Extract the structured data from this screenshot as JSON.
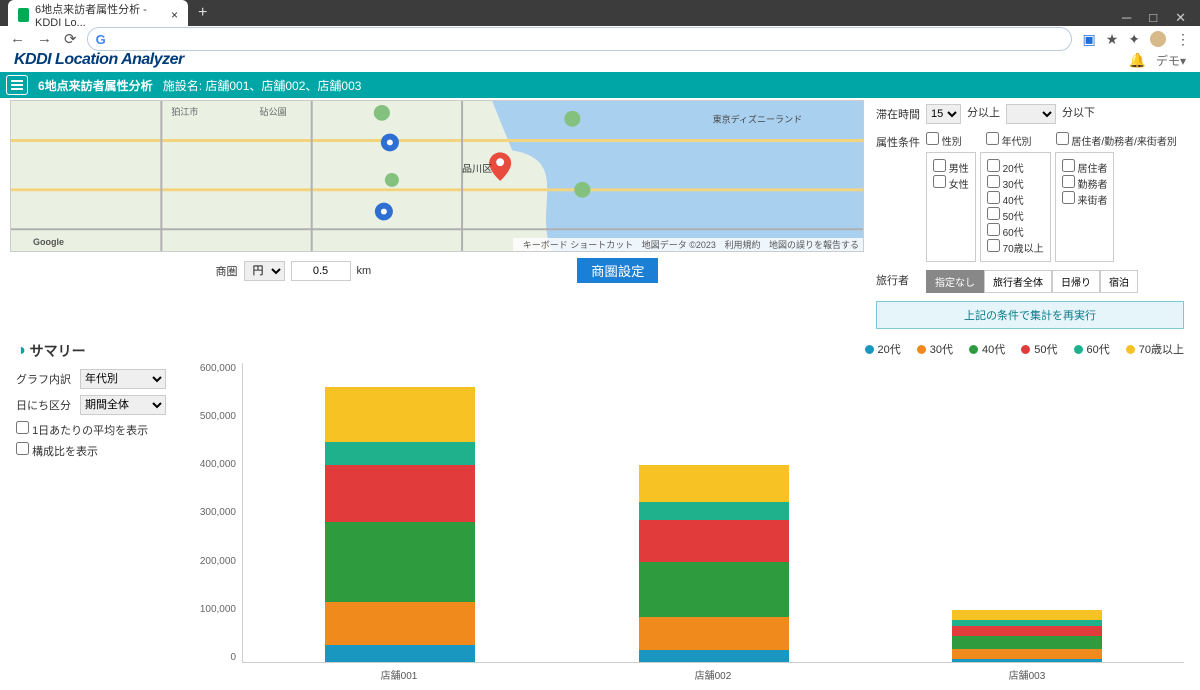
{
  "browser": {
    "tab_title": "6地点来訪者属性分析 - KDDI Lo...",
    "url": ""
  },
  "app": {
    "logo": "KDDI Location Analyzer",
    "user": "デモ▾"
  },
  "tealbar": {
    "title": "6地点来訪者属性分析",
    "subtitle": "施設名: 店舗001、店舗002、店舗003"
  },
  "map": {
    "credits": [
      "キーボード ショートカット",
      "地図データ ©2023",
      "利用規約",
      "地図の誤りを報告する"
    ]
  },
  "area_control": {
    "label": "商圏",
    "shape": "円",
    "radius": "0.5",
    "unit": "km",
    "button": "商圏設定"
  },
  "filters": {
    "stay": {
      "label": "滞在時間",
      "min_value": "15",
      "min_suffix": "分以上",
      "max_value": "",
      "max_suffix": "分以下"
    },
    "attr": {
      "label": "属性条件",
      "headers": [
        "性別",
        "年代別",
        "居住者/勤務者/来街者別"
      ],
      "gender": [
        "男性",
        "女性"
      ],
      "age": [
        "20代",
        "30代",
        "40代",
        "50代",
        "60代",
        "70歳以上"
      ],
      "type": [
        "居住者",
        "勤務者",
        "来街者"
      ]
    },
    "traveler": {
      "label": "旅行者",
      "options": [
        "指定なし",
        "旅行者全体",
        "日帰り",
        "宿泊"
      ],
      "selected": 0
    },
    "rerun": "上記の条件で集計を再実行"
  },
  "summary": {
    "title": "サマリー",
    "breakdown_label": "グラフ内訳",
    "breakdown_value": "年代別",
    "daydiv_label": "日にち区分",
    "daydiv_value": "期間全体",
    "chk_avg": "1日あたりの平均を表示",
    "chk_ratio": "構成比を表示"
  },
  "chart_data": {
    "type": "bar",
    "stacked": true,
    "ylim": [
      0,
      600000
    ],
    "ytick": 100000,
    "ylabel": "",
    "xlabel": "",
    "categories": [
      "店舗001",
      "店舗002",
      "店舗003"
    ],
    "series": [
      {
        "name": "20代",
        "color": "#1a97c1",
        "values": [
          35000,
          25000,
          7000
        ]
      },
      {
        "name": "30代",
        "color": "#f08a1d",
        "values": [
          85000,
          65000,
          20000
        ]
      },
      {
        "name": "40代",
        "color": "#2e9b3e",
        "values": [
          160000,
          110000,
          25000
        ]
      },
      {
        "name": "50代",
        "color": "#e13b3b",
        "values": [
          115000,
          85000,
          20000
        ]
      },
      {
        "name": "60代",
        "color": "#1fb18b",
        "values": [
          45000,
          35000,
          12000
        ]
      },
      {
        "name": "70歳以上",
        "color": "#f6c224",
        "values": [
          110000,
          75000,
          20000
        ]
      }
    ]
  }
}
